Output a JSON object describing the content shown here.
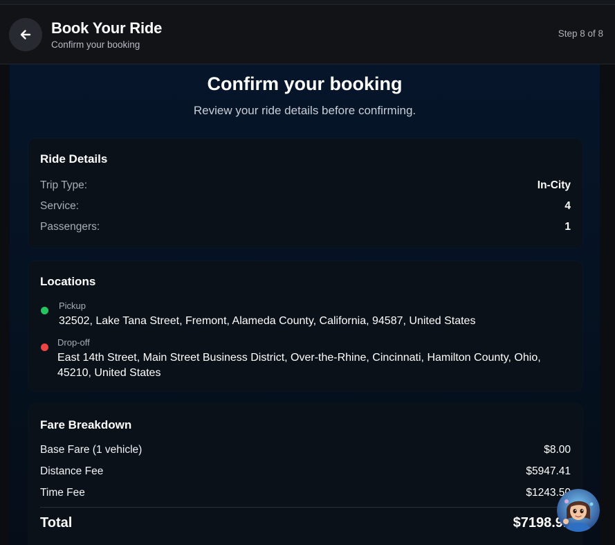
{
  "header": {
    "title": "Book Your Ride",
    "subtitle": "Confirm your booking",
    "step": "Step 8 of 8"
  },
  "main": {
    "title": "Confirm your booking",
    "subtitle": "Review your ride details before confirming."
  },
  "ride_details": {
    "title": "Ride Details",
    "rows": [
      {
        "label": "Trip Type:",
        "value": "In-City"
      },
      {
        "label": "Service:",
        "value": "4"
      },
      {
        "label": "Passengers:",
        "value": "1"
      }
    ]
  },
  "locations": {
    "title": "Locations",
    "pickup": {
      "label": "Pickup",
      "address": "32502, Lake Tana Street, Fremont, Alameda County, California, 94587, United States",
      "color": "#22c55e"
    },
    "dropoff": {
      "label": "Drop-off",
      "address": "East 14th Street, Main Street Business District, Over-the-Rhine, Cincinnati, Hamilton County, Ohio, 45210, United States",
      "color": "#ef4444"
    }
  },
  "fare": {
    "title": "Fare Breakdown",
    "rows": [
      {
        "label": "Base Fare (1 vehicle)",
        "value": "$8.00"
      },
      {
        "label": "Distance Fee",
        "value": "$5947.41"
      },
      {
        "label": "Time Fee",
        "value": "$1243.50"
      }
    ],
    "total_label": "Total",
    "total_value": "$7198.91"
  },
  "icons": {
    "back": "arrow-left-icon",
    "assistant": "assistant-avatar-icon"
  }
}
